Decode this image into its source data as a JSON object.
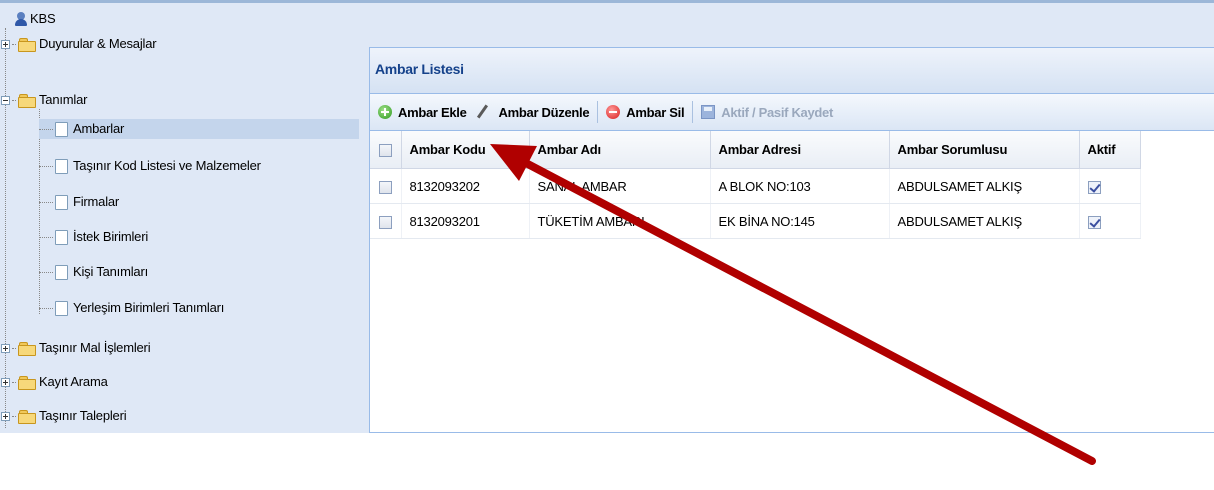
{
  "app": {
    "title": "KBS"
  },
  "tree": {
    "items": [
      {
        "label": "Duyurular & Mesajlar"
      },
      {
        "label": "Tanımlar"
      },
      {
        "label": "Ambarlar"
      },
      {
        "label": "Taşınır Kod Listesi ve Malzemeler"
      },
      {
        "label": "Firmalar"
      },
      {
        "label": "İstek Birimleri"
      },
      {
        "label": "Kişi Tanımları"
      },
      {
        "label": "Yerleşim Birimleri Tanımları"
      },
      {
        "label": "Taşınır Mal İşlemleri"
      },
      {
        "label": "Kayıt Arama"
      },
      {
        "label": "Taşınır Talepleri"
      }
    ],
    "selected": "Ambarlar"
  },
  "panel": {
    "title": "Ambar Listesi",
    "toolbar": {
      "add_label": "Ambar Ekle",
      "edit_label": "Ambar Düzenle",
      "delete_label": "Ambar Sil",
      "save_label": "Aktif / Pasif Kaydet"
    },
    "grid": {
      "columns": [
        "Ambar Kodu",
        "Ambar Adı",
        "Ambar Adresi",
        "Ambar Sorumlusu",
        "Aktif"
      ],
      "rows": [
        {
          "code": "8132093202",
          "name": "SANAL AMBAR",
          "address": "A BLOK NO:103",
          "responsible": "ABDULSAMET ALKIŞ",
          "active": true
        },
        {
          "code": "8132093201",
          "name": "TÜKETİM AMBARI",
          "address": "EK BİNA NO:145",
          "responsible": "ABDULSAMET ALKIŞ",
          "active": true
        }
      ]
    }
  },
  "colors": {
    "arrow": "#b00000",
    "panel_title": "#15428b",
    "tree_background": "#dfe8f6"
  }
}
